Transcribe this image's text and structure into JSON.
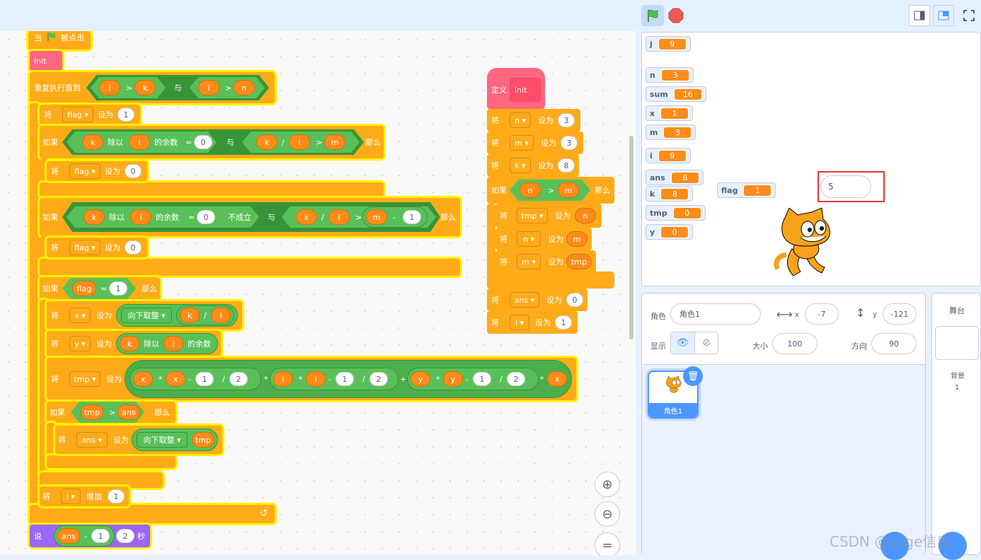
{
  "toolbar": {
    "green_flag": "green-flag",
    "stop": "stop"
  },
  "script": {
    "hat": {
      "when": "当",
      "clicked": "被点击"
    },
    "init_call": "init",
    "repeat_until": {
      "label": "重复执行直到",
      "i": "i",
      "gt": ">",
      "k": "k",
      "and": "与",
      "i2": "i",
      "gt2": ">",
      "n": "n"
    },
    "set_flag_1": {
      "set": "将",
      "var": "flag",
      "to": "设为",
      "val": "1"
    },
    "if1": {
      "if": "如果",
      "k": "k",
      "mod": "除以",
      "i": "i",
      "rem": "的余数",
      "eq": "=",
      "zero": "0",
      "and": "与",
      "k2": "k",
      "div": "/",
      "i2": "i",
      "gt": ">",
      "m": "m",
      "then": "那么"
    },
    "set_flag_0a": {
      "set": "将",
      "var": "flag",
      "to": "设为",
      "val": "0"
    },
    "if2": {
      "if": "如果",
      "k": "k",
      "mod": "除以",
      "i": "i",
      "rem": "的余数",
      "eq": "=",
      "zero": "0",
      "not": "不成立",
      "and": "与",
      "k2": "k",
      "div": "/",
      "i2": "i",
      "gt": ">",
      "m": "m",
      "minus": "-",
      "one": "1",
      "then": "那么"
    },
    "set_flag_0b": {
      "set": "将",
      "var": "flag",
      "to": "设为",
      "val": "0"
    },
    "if3": {
      "if": "如果",
      "flag": "flag",
      "eq": "=",
      "one": "1",
      "then": "那么"
    },
    "set_x": {
      "set": "将",
      "var": "x",
      "to": "设为",
      "floor": "向下取整",
      "k": "k",
      "div": "/",
      "i": "i"
    },
    "set_y": {
      "set": "将",
      "var": "y",
      "to": "设为",
      "k": "k",
      "mod": "除以",
      "i": "i",
      "rem": "的余数"
    },
    "set_tmp": {
      "set": "将",
      "var": "tmp",
      "to": "设为",
      "x": "x",
      "mul": "*",
      "x2": "x",
      "minus": "-",
      "one": "1",
      "div": "/",
      "two": "2",
      "mul2": "*",
      "i": "i",
      "mul3": "*",
      "i2": "i",
      "minus2": "-",
      "one2": "1",
      "div2": "/",
      "two2": "2",
      "plus": "+",
      "y": "y",
      "mul4": "*",
      "y2": "y",
      "minus3": "-",
      "one3": "1",
      "div3": "/",
      "two3": "2",
      "mul5": "*",
      "x3": "x"
    },
    "if4": {
      "if": "如果",
      "tmp": "tmp",
      "gt": ">",
      "ans": "ans",
      "then": "那么"
    },
    "set_ans": {
      "set": "将",
      "var": "ans",
      "to": "设为",
      "floor": "向下取整",
      "tmp": "tmp"
    },
    "change_i": {
      "set": "将",
      "var": "i",
      "inc": "增加",
      "val": "1"
    },
    "say": {
      "say": "说",
      "ans": "ans",
      "minus": "-",
      "one": "1",
      "two": "2",
      "secs": "秒"
    }
  },
  "define": {
    "def": "定义",
    "name": "init",
    "rows": [
      {
        "set": "将",
        "var": "n",
        "to": "设为",
        "val": "3"
      },
      {
        "set": "将",
        "var": "m",
        "to": "设为",
        "val": "3"
      },
      {
        "set": "将",
        "var": "k",
        "to": "设为",
        "val": "8"
      }
    ],
    "if": {
      "if": "如果",
      "n": "n",
      "gt": ">",
      "m": "m",
      "then": "那么"
    },
    "inner": [
      {
        "set": "将",
        "var": "tmp",
        "to": "设为",
        "val": "n"
      },
      {
        "set": "将",
        "var": "n",
        "to": "设为",
        "val": "m"
      },
      {
        "set": "将",
        "var": "m",
        "to": "设为",
        "val": "tmp"
      }
    ],
    "after": [
      {
        "set": "将",
        "var": "ans",
        "to": "设为",
        "val": "0"
      },
      {
        "set": "将",
        "var": "i",
        "to": "设为",
        "val": "1"
      }
    ]
  },
  "monitors": [
    {
      "name": "j",
      "value": "9"
    },
    {
      "name": "n",
      "value": "3"
    },
    {
      "name": "sum",
      "value": "16"
    },
    {
      "name": "x",
      "value": "1"
    },
    {
      "name": "m",
      "value": "3"
    },
    {
      "name": "i",
      "value": "9"
    },
    {
      "name": "ans",
      "value": "6"
    },
    {
      "name": "k",
      "value": "8"
    },
    {
      "name": "tmp",
      "value": "0"
    },
    {
      "name": "y",
      "value": "0"
    },
    {
      "name": "flag",
      "value": "1"
    }
  ],
  "speech": "5",
  "sprite_info": {
    "sprite_label": "角色",
    "sprite_name": "角色1",
    "x_label": "x",
    "x": "-7",
    "y_label": "y",
    "y": "-121",
    "show_label": "显示",
    "size_label": "大小",
    "size": "100",
    "dir_label": "方向",
    "dir": "90"
  },
  "sprite_tile": {
    "name": "角色1"
  },
  "stage_panel": {
    "title": "舞台",
    "backdrops_label": "背景",
    "count": "1"
  },
  "watermark": "CSDN @Loge信奥"
}
